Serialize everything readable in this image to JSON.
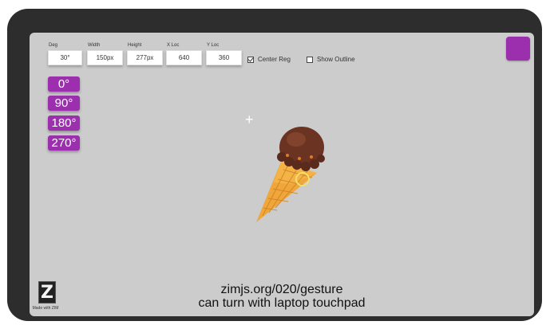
{
  "fields": [
    {
      "label": "Deg",
      "value": "30°"
    },
    {
      "label": "Width",
      "value": "150px"
    },
    {
      "label": "Height",
      "value": "277px"
    },
    {
      "label": "X Loc",
      "value": "640"
    },
    {
      "label": "Y Loc",
      "value": "360"
    }
  ],
  "checkboxes": [
    {
      "label": "Center Reg",
      "checked": true
    },
    {
      "label": "Show Outline",
      "checked": false
    }
  ],
  "rotate_buttons": [
    "0°",
    "90°",
    "180°",
    "270°"
  ],
  "crosshair": "+",
  "logo": {
    "mark": "Z",
    "caption": "Made with ZIM"
  },
  "caption": {
    "line1": "zimjs.org/020/gesture",
    "line2": "can turn with laptop touchpad"
  },
  "colors": {
    "accent": "#9b2fae",
    "stage": "#cccccc",
    "frame": "#2d2d2d",
    "cone": "#f0a63a",
    "scoop": "#6b3322",
    "ring": "#f3df6b"
  },
  "icons": [
    "crosshair-icon",
    "ice-cream-cone-image",
    "rotation-handle-icon",
    "zim-logo-icon"
  ]
}
